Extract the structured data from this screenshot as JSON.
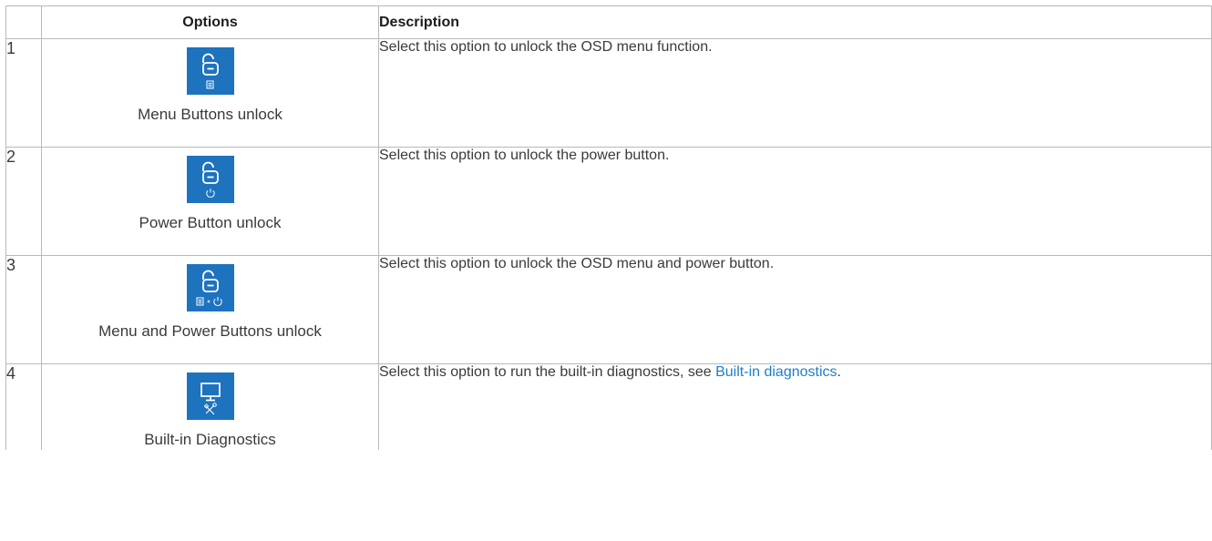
{
  "table": {
    "headers": {
      "number": "",
      "options": "Options",
      "description": "Description"
    },
    "rows": [
      {
        "number": "1",
        "option_label": "Menu Buttons unlock",
        "icon": "unlock-menu-icon",
        "description": "Select this option to unlock the OSD menu function.",
        "link": "",
        "trailing": ""
      },
      {
        "number": "2",
        "option_label": "Power Button unlock",
        "icon": "unlock-power-icon",
        "description": "Select this option to unlock the power button.",
        "link": "",
        "trailing": ""
      },
      {
        "number": "3",
        "option_label": "Menu and Power Buttons unlock",
        "icon": "unlock-menu-power-icon",
        "description": "Select this option to unlock the OSD menu and power button.",
        "link": "",
        "trailing": ""
      },
      {
        "number": "4",
        "option_label": "Built-in Diagnostics",
        "icon": "monitor-tools-icon",
        "description": "Select this option to run the built-in diagnostics, see ",
        "link": "Built-in diagnostics",
        "trailing": "."
      }
    ]
  },
  "colors": {
    "tile": "#1e73be",
    "link": "#1e7ec8",
    "border": "#b9b9b9"
  }
}
